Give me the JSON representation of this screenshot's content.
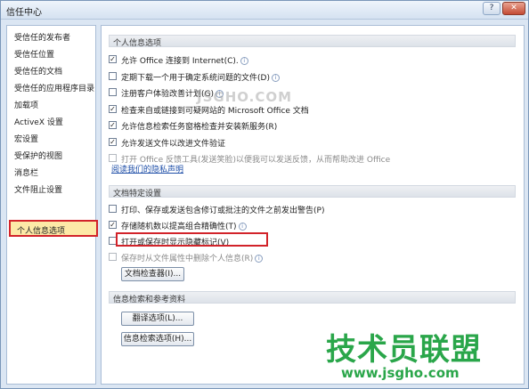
{
  "window": {
    "title": "信任中心",
    "help_label": "?",
    "close_label": "✕"
  },
  "sidebar": {
    "items": [
      {
        "label": "受信任的发布者"
      },
      {
        "label": "受信任位置"
      },
      {
        "label": "受信任的文档"
      },
      {
        "label": "受信任的应用程序目录"
      },
      {
        "label": "加载项"
      },
      {
        "label": "ActiveX 设置"
      },
      {
        "label": "宏设置"
      },
      {
        "label": "受保护的视图"
      },
      {
        "label": "消息栏"
      },
      {
        "label": "文件阻止设置"
      },
      {
        "label": "个人信息选项",
        "selected": true
      }
    ]
  },
  "personal_section": {
    "header": "个人信息选项",
    "options": [
      {
        "label": "允许 Office 连接到 Internet(C).",
        "checked": true,
        "enabled": true
      },
      {
        "label": "定期下载一个用于确定系统问题的文件(D)",
        "checked": false,
        "enabled": true
      },
      {
        "label": "注册客户体验改善计划(G)",
        "checked": false,
        "enabled": true
      },
      {
        "label": "检查来自或链接到可疑网站的 Microsoft Office 文档",
        "checked": true,
        "enabled": true
      },
      {
        "label": "允许信息检索任务窗格检查并安装新服务(R)",
        "checked": true,
        "enabled": true
      },
      {
        "label": "允许发送文件以改进文件验证",
        "checked": true,
        "enabled": true
      },
      {
        "label": "打开 Office 反馈工具(发送笑脸)以便我可以发送反馈，从而帮助改进 Office",
        "checked": false,
        "enabled": false
      }
    ],
    "privacy_link": "阅读我们的隐私声明"
  },
  "document_section": {
    "header": "文档特定设置",
    "options": [
      {
        "label": "打印、保存或发送包含修订或批注的文件之前发出警告(P)",
        "checked": false,
        "enabled": true
      },
      {
        "label": "存储随机数以提高组合精确性(T)",
        "checked": true,
        "enabled": true
      },
      {
        "label": "打开或保存时显示隐藏标记(V)",
        "checked": false,
        "enabled": true
      },
      {
        "label": "保存时从文件属性中删除个人信息(R)",
        "checked": false,
        "enabled": false
      }
    ],
    "inspector_button": "文档检查器(I)..."
  },
  "research_section": {
    "header": "信息检索和参考资料",
    "translate_button": "翻译选项(L)...",
    "research_button": "信息检索选项(H)..."
  },
  "watermarks": {
    "site_mark": "JSGHO.COM",
    "brand_cn": "技术员联盟",
    "brand_url": "www.jsgho.com"
  }
}
